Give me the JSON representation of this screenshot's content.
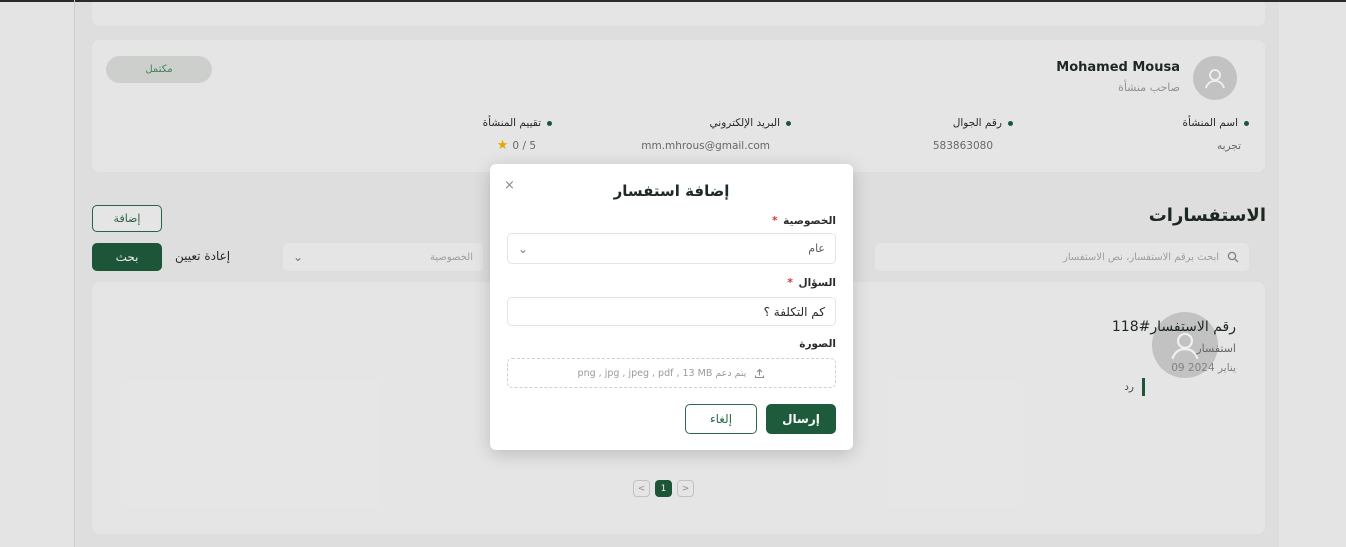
{
  "profile": {
    "status_badge": "مكتمل",
    "owner_name": "Mohamed Mousa",
    "owner_role": "صاحب منشأة",
    "fields": [
      {
        "label": "اسم المنشأة",
        "value": "تجربه"
      },
      {
        "label": "رقم الجوال",
        "value": "583863080"
      },
      {
        "label": "البريد الإلكتروني",
        "value": "mm.mhrous@gmail.com"
      },
      {
        "label": "تقييم المنشأة",
        "value": "0 / 5"
      }
    ]
  },
  "inquiries": {
    "title": "الاستفسارات",
    "add_label": "إضافة",
    "search_label": "بحث",
    "reset_label": "إعادة تعيين",
    "privacy_placeholder": "الخصوصية",
    "search_placeholder": "ابحث برقم الاستفسار، نص الاستفسار",
    "item": {
      "title": "رقم الاستفسار#118",
      "type": "استفسار",
      "date": "09 يناير 2024",
      "reply": "رد"
    },
    "pagination": {
      "prev": "<",
      "current": "1",
      "next": ">"
    }
  },
  "modal": {
    "title": "إضافة استفسار",
    "close": "×",
    "privacy_label": "الخصوصية",
    "privacy_value": "عام",
    "question_label": "السؤال",
    "question_value": "كم التكلفة ؟",
    "image_label": "الصورة",
    "upload_hint": "يتم دعم png , jpg , jpeg , pdf , 13 MB",
    "send_label": "إرسال",
    "cancel_label": "إلغاء",
    "required_mark": "*"
  },
  "colors": {
    "primary": "#1e5b3c",
    "star": "#f0b400"
  }
}
